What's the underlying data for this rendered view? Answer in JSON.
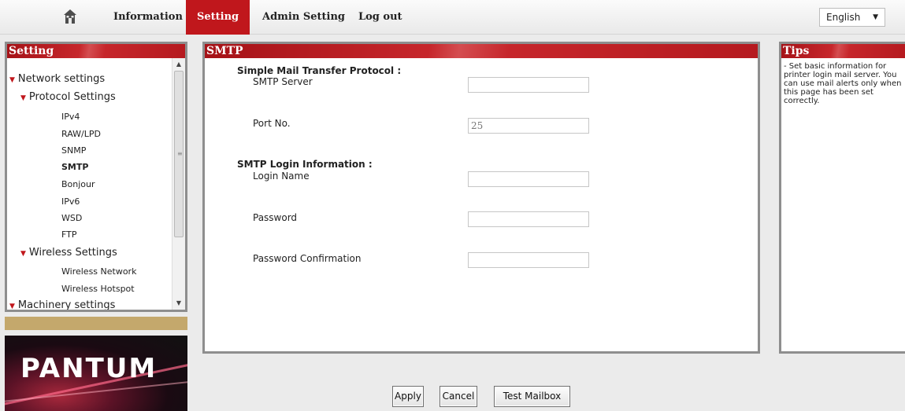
{
  "nav": {
    "home_icon": "home-icon",
    "items": [
      "Information",
      "Setting",
      "Admin Setting",
      "Log out"
    ],
    "active": "Setting",
    "language": "English"
  },
  "sidebar": {
    "title": "Setting",
    "tree": {
      "network": "Network settings",
      "protocol": "Protocol Settings",
      "protocol_items": [
        "IPv4",
        "RAW/LPD",
        "SNMP",
        "SMTP",
        "Bonjour",
        "IPv6",
        "WSD",
        "FTP"
      ],
      "selected": "SMTP",
      "wireless": "Wireless Settings",
      "wireless_items": [
        "Wireless Network",
        "Wireless Hotspot"
      ],
      "machinery": "Machinery settings"
    }
  },
  "logo": {
    "text": "PANTUM"
  },
  "main": {
    "title": "SMTP",
    "section1": "Simple Mail Transfer Protocol :",
    "smtp_server_label": "SMTP Server",
    "smtp_server_value": "",
    "port_label": "Port No.",
    "port_value": "25",
    "section2": "SMTP Login Information :",
    "login_label": "Login Name",
    "login_value": "",
    "password_label": "Password",
    "password_value": "",
    "confirm_label": "Password Confirmation",
    "confirm_value": ""
  },
  "tips": {
    "title": "Tips",
    "text": "- Set basic information for printer login mail server. You can use mail alerts only when this page has been set correctly."
  },
  "buttons": {
    "apply": "Apply",
    "cancel": "Cancel",
    "test": "Test Mailbox"
  },
  "colors": {
    "accent": "#c0171c",
    "panel_border": "#8e8e8e",
    "background": "#ebebeb"
  }
}
